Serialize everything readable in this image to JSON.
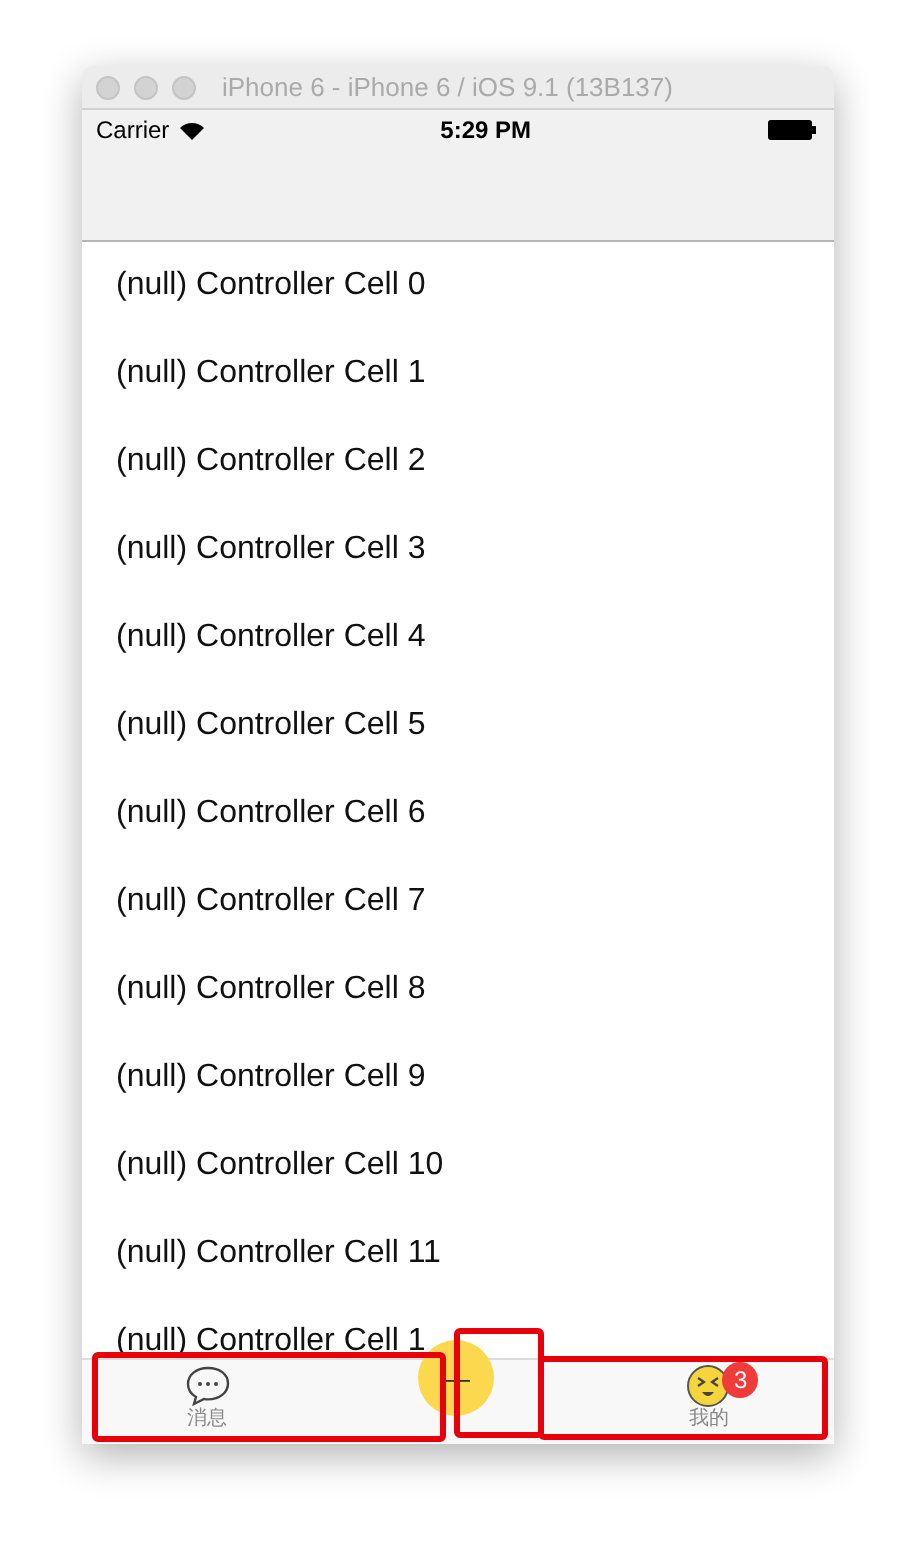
{
  "window": {
    "title": "iPhone 6 - iPhone 6 / iOS 9.1 (13B137)"
  },
  "status_bar": {
    "carrier": "Carrier",
    "time": "5:29 PM"
  },
  "table": {
    "rows": [
      "(null) Controller Cell 0",
      "(null) Controller Cell 1",
      "(null) Controller Cell 2",
      "(null) Controller Cell 3",
      "(null) Controller Cell 4",
      "(null) Controller Cell 5",
      "(null) Controller Cell 6",
      "(null) Controller Cell 7",
      "(null) Controller Cell 8",
      "(null) Controller Cell 9",
      "(null) Controller Cell 10",
      "(null) Controller Cell 11",
      "(null) Controller Cell 1"
    ]
  },
  "tab_bar": {
    "tabs": [
      {
        "kind": "chat",
        "label": "消息"
      },
      {
        "kind": "publish",
        "symbol": "—"
      },
      {
        "kind": "face",
        "label": "我的",
        "badge": "3"
      }
    ]
  },
  "highlights": [
    {
      "kind": "left"
    },
    {
      "kind": "center"
    },
    {
      "kind": "right"
    }
  ]
}
